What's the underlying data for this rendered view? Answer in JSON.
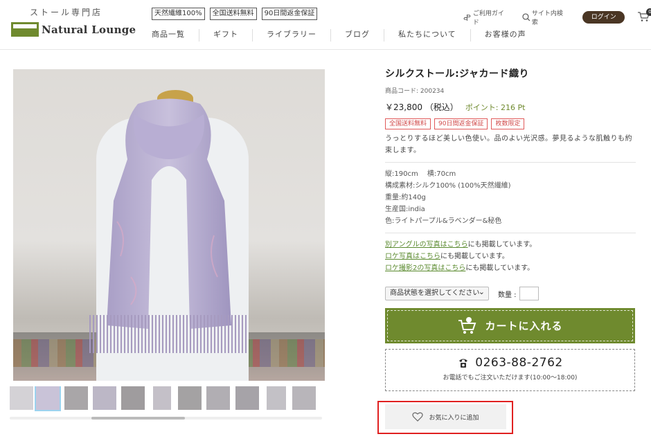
{
  "header": {
    "logo_sub": "ストール専門店",
    "logo_text": "Natural Lounge",
    "badges": [
      "天然繊維100%",
      "全国送料無料",
      "90日間返金保証"
    ],
    "nav": [
      "商品一覧",
      "ギフト",
      "ライブラリー",
      "ブログ",
      "私たちについて",
      "お客様の声"
    ],
    "guide_label": "ご利用ガイド",
    "search_label": "サイト内検索",
    "login_label": "ログイン",
    "cart_count": "0"
  },
  "product": {
    "title": "シルクストール:ジャカード織り",
    "code": "商品コード: 200234",
    "price": "￥23,800 （税込）",
    "point": "ポイント: 216 Pt",
    "tags": [
      "全国送料無料",
      "90日間返金保証",
      "枚数限定"
    ],
    "description": "うっとりするほど美しい色使い。品のよい光沢感。夢見るような肌触りも約束します。",
    "specs": [
      "縦:190cm　 横:70cm",
      "構成素材:シルク100% (100%天然繊維)",
      "重量:約140g",
      "生産国:india",
      "色:ライトパープル&ラベンダー&秘色"
    ],
    "links": [
      {
        "link": "別アングルの写真はこちら",
        "rest": "にも掲載しています。"
      },
      {
        "link": "ロケ写真はこちら",
        "rest": "にも掲載しています。"
      },
      {
        "link": "ロケ撮影2の写真はこちら",
        "rest": "にも掲載しています。"
      }
    ],
    "select_value": "商品状態を選択してください",
    "qty_label": "数量 :",
    "cart_button": "カートに入れる",
    "tel": "0263-88-2762",
    "tel_note": "お電話でもご注文いただけます(10:00〜18:00)",
    "favorite_button": "お気に入りに追加"
  },
  "colors": {
    "brand_green": "#6f8a2e",
    "login_brown": "#4a3624",
    "tag_red": "#d04a4a",
    "highlight_red": "#e02020"
  }
}
